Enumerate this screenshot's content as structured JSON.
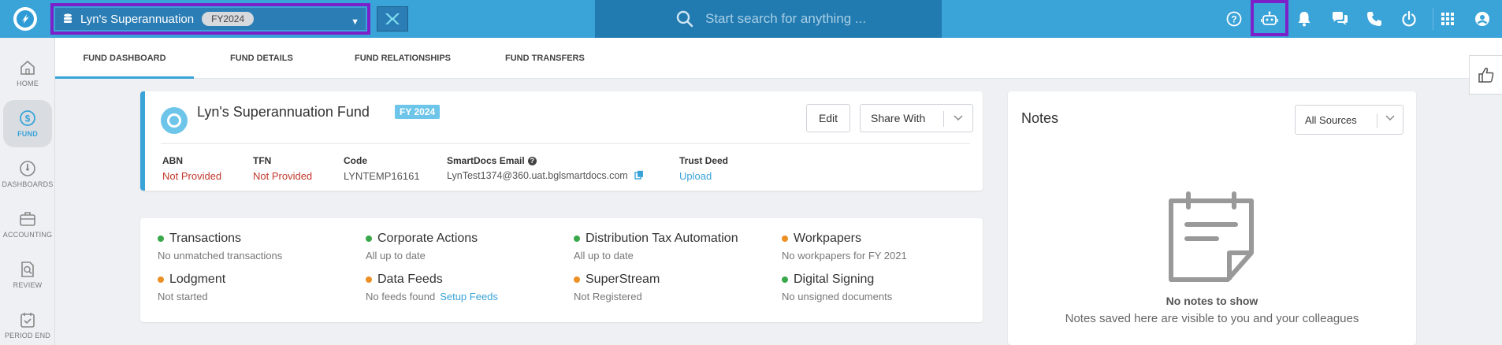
{
  "header": {
    "fund_name": "Lyn's Superannuation",
    "fund_year": "FY2024",
    "search_placeholder": "Start search for anything ...",
    "icons": [
      "help-icon",
      "robot-icon",
      "bell-icon",
      "chat-icon",
      "phone-icon",
      "power-icon",
      "apps-grid-icon",
      "user-icon"
    ]
  },
  "sidebar": {
    "items": [
      {
        "label": "HOME",
        "icon": "home-icon"
      },
      {
        "label": "FUND",
        "icon": "dollar-icon"
      },
      {
        "label": "DASHBOARDS",
        "icon": "gauge-icon"
      },
      {
        "label": "ACCOUNTING",
        "icon": "briefcase-icon"
      },
      {
        "label": "REVIEW",
        "icon": "review-icon"
      },
      {
        "label": "PERIOD END",
        "icon": "calendar-check-icon"
      }
    ]
  },
  "tabs": [
    {
      "label": "FUND DASHBOARD"
    },
    {
      "label": "FUND DETAILS"
    },
    {
      "label": "FUND RELATIONSHIPS"
    },
    {
      "label": "FUND TRANSFERS"
    }
  ],
  "fund_card": {
    "title": "Lyn's Superannuation Fund",
    "fy_badge": "FY 2024",
    "edit_label": "Edit",
    "share_label": "Share With",
    "fields": {
      "abn_label": "ABN",
      "abn_value": "Not Provided",
      "tfn_label": "TFN",
      "tfn_value": "Not Provided",
      "code_label": "Code",
      "code_value": "LYNTEMP16161",
      "email_label": "SmartDocs Email",
      "email_value": "LynTest1374@360.uat.bglsmartdocs.com",
      "trust_label": "Trust Deed",
      "trust_value": "Upload"
    }
  },
  "status": {
    "items": [
      {
        "title": "Transactions",
        "sub": "No unmatched transactions",
        "color": "#3aa84a"
      },
      {
        "title": "Corporate Actions",
        "sub": "All up to date",
        "color": "#3aa84a"
      },
      {
        "title": "Distribution Tax Automation",
        "sub": "All up to date",
        "color": "#3aa84a"
      },
      {
        "title": "Workpapers",
        "sub": "No workpapers for FY 2021",
        "color": "#ec8f24"
      },
      {
        "title": "Lodgment",
        "sub": "Not started",
        "color": "#ec8f24"
      },
      {
        "title": "Data Feeds",
        "sub": "No feeds found",
        "link": "Setup Feeds",
        "color": "#ec8f24"
      },
      {
        "title": "SuperStream",
        "sub": "Not Registered",
        "color": "#ec8f24"
      },
      {
        "title": "Digital Signing",
        "sub": "No unsigned documents",
        "color": "#3aa84a"
      }
    ]
  },
  "notes": {
    "title": "Notes",
    "sources_label": "All Sources",
    "empty_title": "No notes to show",
    "empty_sub": "Notes saved here are visible to you and your colleagues"
  },
  "colors": {
    "topbar": "#3aa3d8",
    "search": "#217ab0",
    "highlight": "#7c21c9",
    "accent": "#3aa3d8",
    "not_provided": "#c0392b"
  }
}
